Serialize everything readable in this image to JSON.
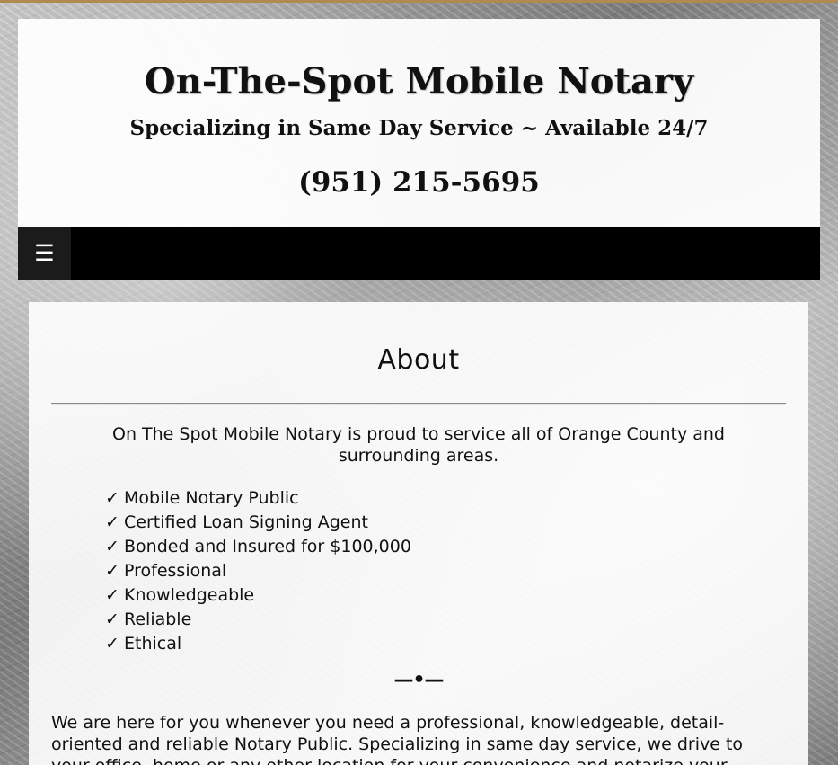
{
  "header": {
    "title": "On-The-Spot Mobile Notary",
    "tagline": "Specializing in Same Day Service ~ Available 24/7",
    "phone": "(951) 215-5695"
  },
  "nav": {
    "menu_icon": "☰"
  },
  "about": {
    "title": "About",
    "intro": "On The Spot Mobile Notary is proud to service all of Orange County and surrounding areas.",
    "check_glyph": "✓",
    "features": [
      "Mobile Notary Public",
      "Certified Loan Signing Agent",
      "Bonded and Insured for $100,000",
      "Professional",
      "Knowledgeable",
      "Reliable",
      "Ethical"
    ],
    "divider": "—•—",
    "body": "We are here for you whenever you need a professional, knowledgeable, detail-oriented and reliable Notary Public. Specializing in same day service, we drive to your office, home or any other location for your convenience and notarize your"
  },
  "colors": {
    "nav_background": "#000000",
    "accent_strip": "#b08a4e",
    "text": "#111111"
  }
}
